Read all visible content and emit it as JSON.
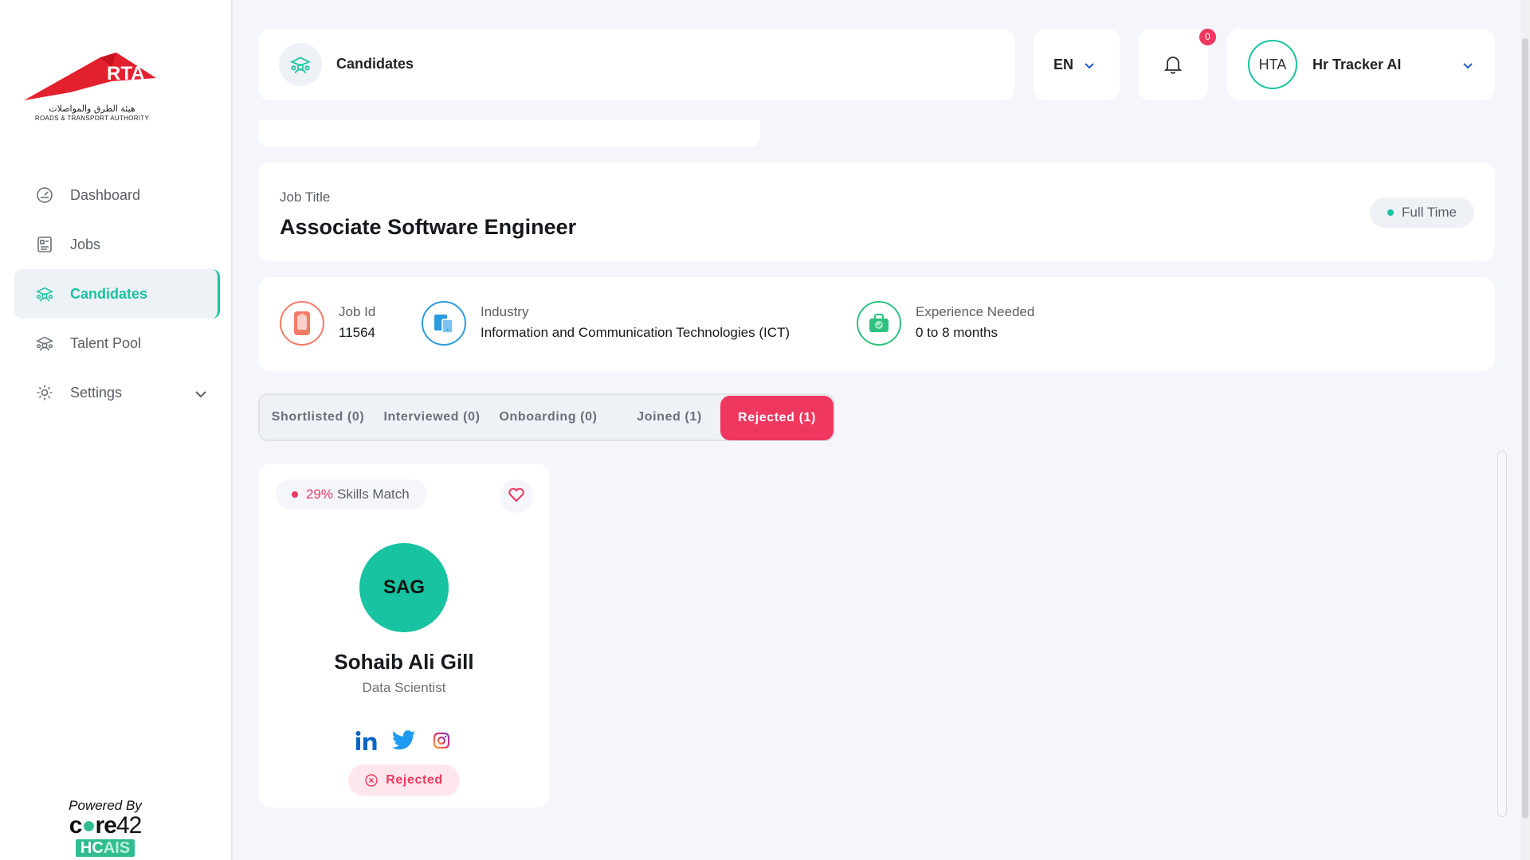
{
  "app": {
    "logo_text": "RTA",
    "logo_arabic": "هيئة الطرق والمواصلات",
    "logo_english": "ROADS & TRANSPORT AUTHORITY",
    "powered_by": "Powered By",
    "powered_brand_a": "c",
    "powered_brand_b": "re",
    "powered_brand_c": "42",
    "powered_badge_a": "HC",
    "powered_badge_b": "AIS"
  },
  "sidebar": {
    "items": [
      {
        "label": "Dashboard",
        "icon": "dashboard-gauge-icon"
      },
      {
        "label": "Jobs",
        "icon": "jobs-list-icon"
      },
      {
        "label": "Candidates",
        "icon": "candidates-icon"
      },
      {
        "label": "Talent Pool",
        "icon": "talent-pool-icon"
      },
      {
        "label": "Settings",
        "icon": "gear-icon"
      }
    ],
    "active": "Candidates"
  },
  "header": {
    "title": "Candidates",
    "language": "EN",
    "notifications_count": "0",
    "user_initials": "HTA",
    "user_name": "Hr Tracker AI"
  },
  "job": {
    "title_label": "Job Title",
    "title": "Associate Software Engineer",
    "employment_type": "Full Time",
    "info": [
      {
        "label": "Job Id",
        "value": "11564"
      },
      {
        "label": "Industry",
        "value": "Information and Communication Technologies (ICT)"
      },
      {
        "label": "Experience Needed",
        "value": "0 to 8 months"
      }
    ]
  },
  "tabs": [
    {
      "label": "Shortlisted (0)"
    },
    {
      "label": "Interviewed (0)"
    },
    {
      "label": "Onboarding (0)"
    },
    {
      "label": "Joined (1)"
    },
    {
      "label": "Rejected (1)"
    }
  ],
  "active_tab": "Rejected (1)",
  "candidates": [
    {
      "match_percent": "29%",
      "match_label": "Skills Match",
      "initials": "SAG",
      "name": "Sohaib Ali Gill",
      "role": "Data Scientist",
      "socials": [
        "linkedin-icon",
        "twitter-icon",
        "instagram-icon"
      ],
      "status": "Rejected"
    }
  ],
  "colors": {
    "accent": "#17c3a0",
    "danger": "#f0375f",
    "background": "#f4f6fb",
    "brand_red": "#e3202e"
  }
}
